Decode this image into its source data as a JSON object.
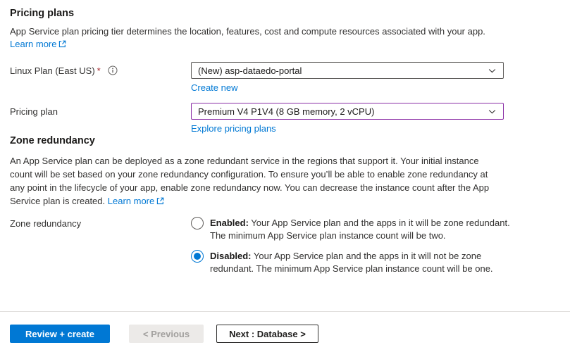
{
  "colors": {
    "accent_blue": "#0078d4",
    "dirty_field_purple": "#8a2da5",
    "required_red": "#a4262c",
    "text": "#323130",
    "divider": "#e1dfdd"
  },
  "pricing_section": {
    "title": "Pricing plans",
    "description": "App Service plan pricing tier determines the location, features, cost and compute resources associated with your app.",
    "learn_more_label": "Learn more",
    "linux_plan": {
      "label": "Linux Plan (East US)",
      "required_marker": "*",
      "value": "(New) asp-dataedo-portal",
      "create_new_label": "Create new"
    },
    "pricing_plan": {
      "label": "Pricing plan",
      "value": "Premium V4 P1V4 (8 GB memory, 2 vCPU)",
      "explore_label": "Explore pricing plans"
    }
  },
  "zone_section": {
    "title": "Zone redundancy",
    "description": "An App Service plan can be deployed as a zone redundant service in the regions that support it. Your initial instance count will be set based on your zone redundancy configuration. To ensure you’ll be able to enable zone redundancy at any point in the lifecycle of your app, enable zone redundancy now. You can decrease the instance count after the App Service plan is created.",
    "learn_more_label": "Learn more",
    "field_label": "Zone redundancy",
    "options": [
      {
        "label": "Enabled:",
        "text": "Your App Service plan and the apps in it will be zone redundant. The minimum App Service plan instance count will be two.",
        "selected": false
      },
      {
        "label": "Disabled:",
        "text": "Your App Service plan and the apps in it will not be zone redundant. The minimum App Service plan instance count will be one.",
        "selected": true
      }
    ]
  },
  "footer": {
    "review_create_label": "Review + create",
    "previous_label": "< Previous",
    "next_label": "Next : Database >"
  }
}
